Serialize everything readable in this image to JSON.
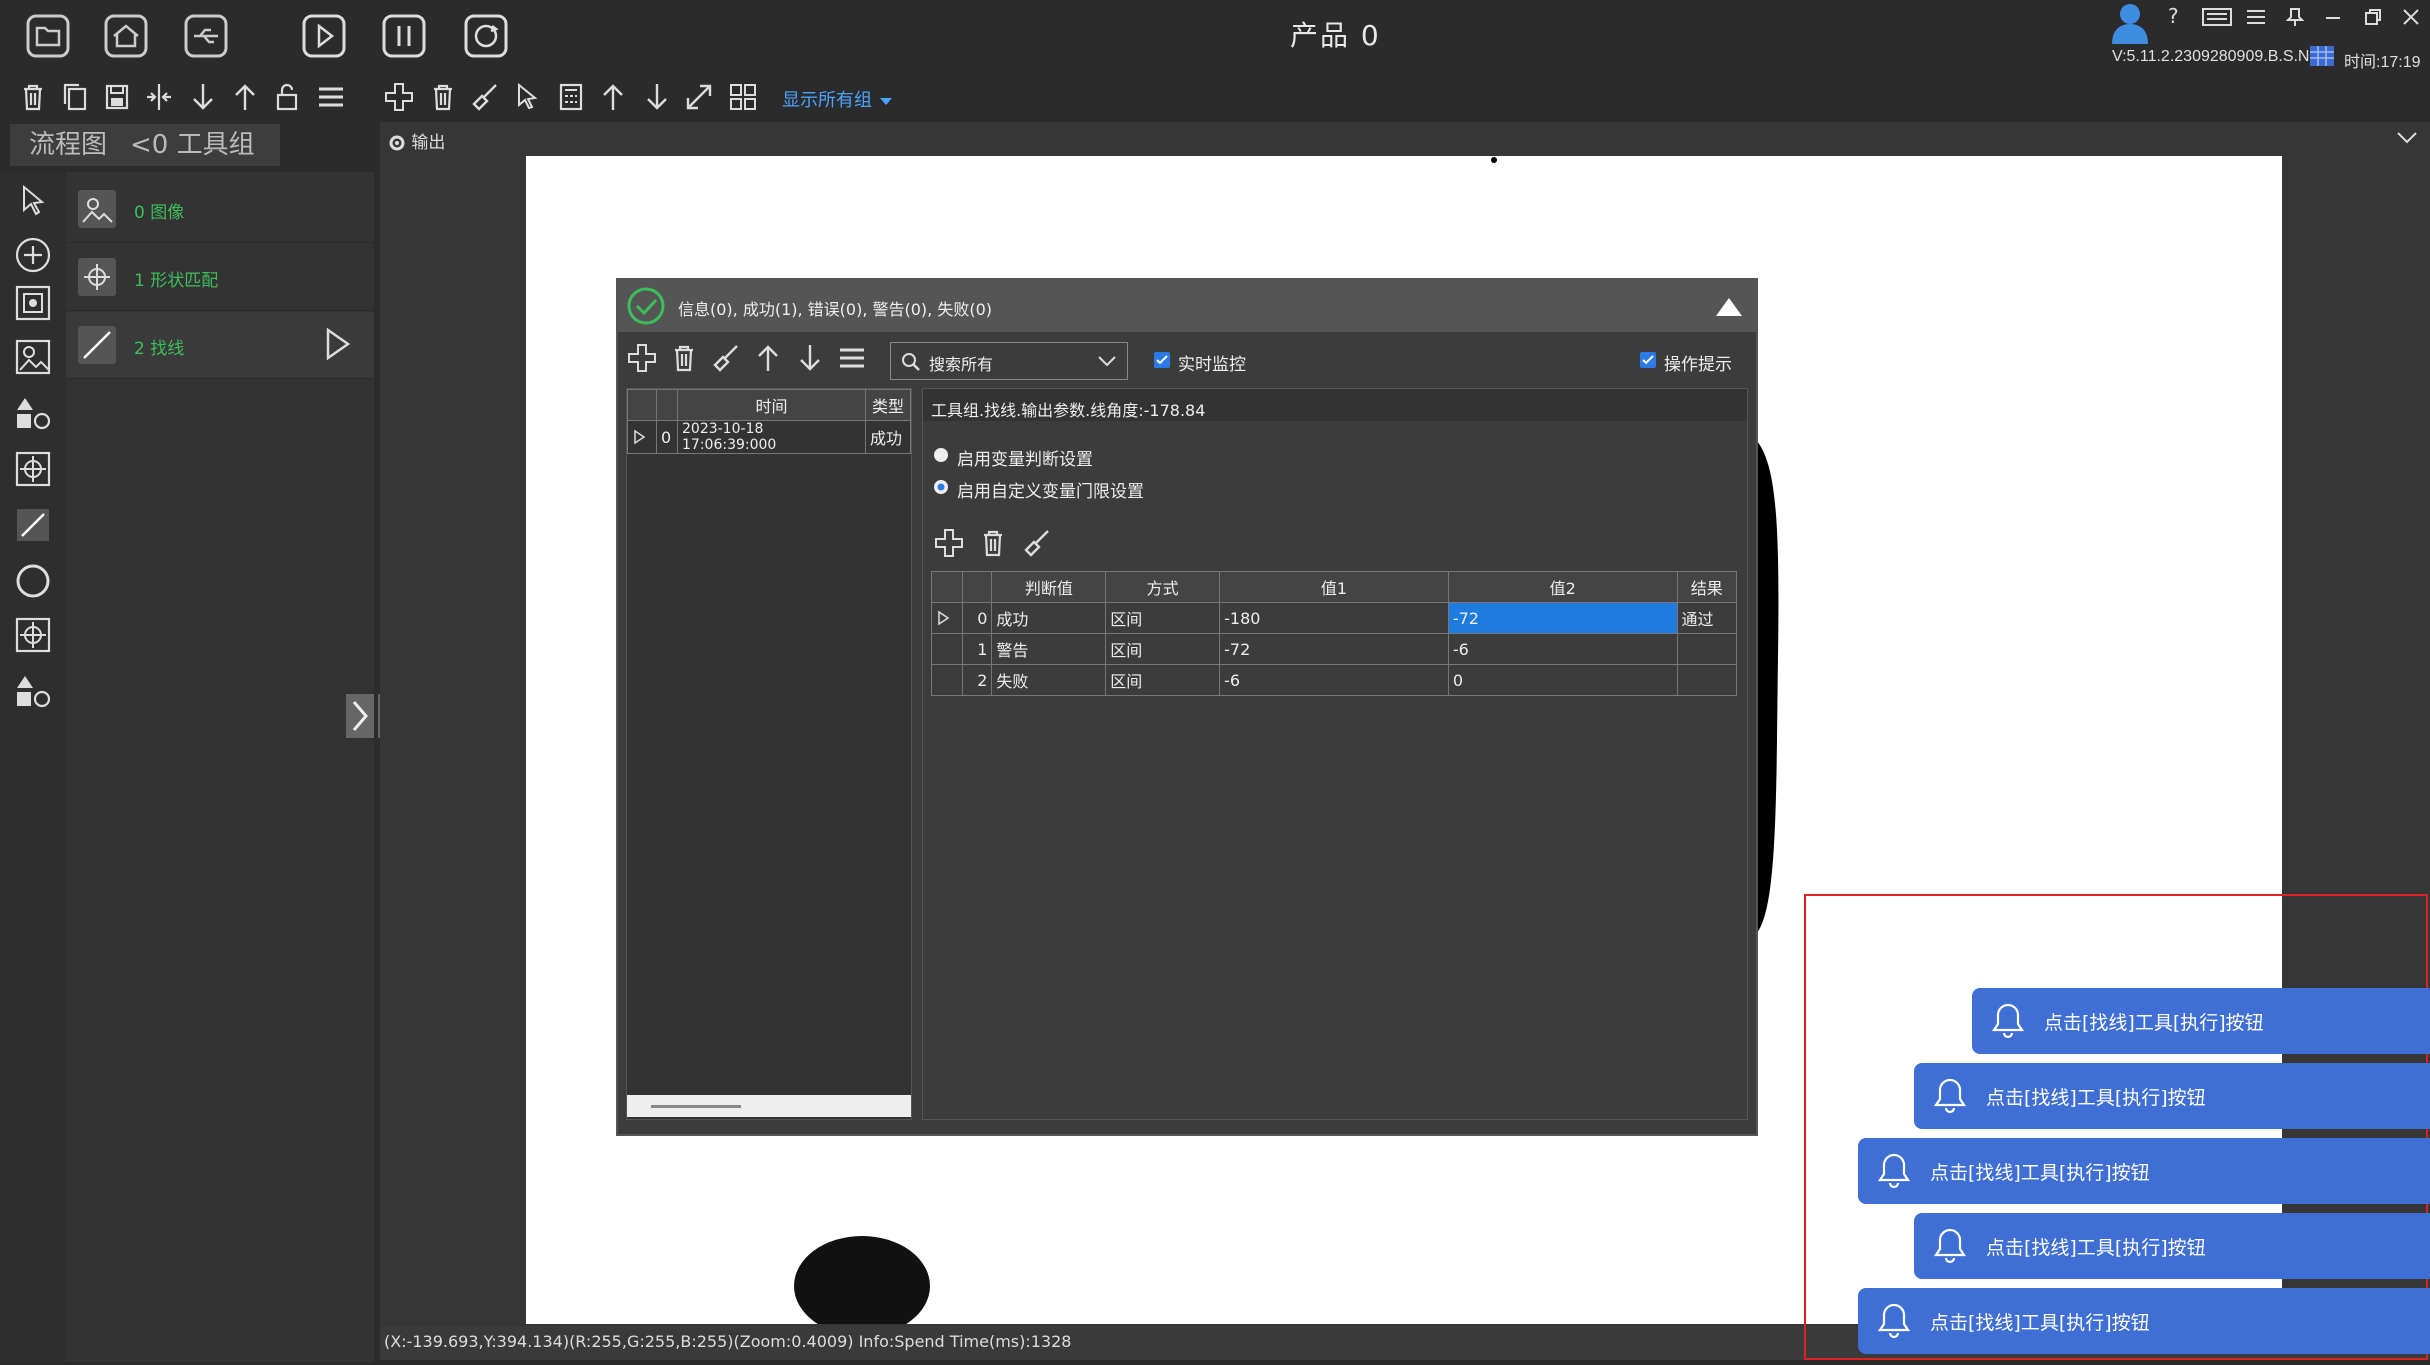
{
  "app": {
    "title": "产品 0",
    "version": "V:5.11.2.2309280909.B.S.N",
    "time": "时间:17:19"
  },
  "toolbar2": {
    "show_all_groups": "显示所有组"
  },
  "tabs": [
    {
      "label": "流程图"
    },
    {
      "label": "<0 工具组"
    }
  ],
  "nodes": [
    {
      "label": "0 图像"
    },
    {
      "label": "1 形状匹配"
    },
    {
      "label": "2 找线"
    }
  ],
  "output_header": "输出",
  "dialog": {
    "title": "信息(0), 成功(1), 错误(0), 警告(0), 失败(0)",
    "search_placeholder": "搜索所有",
    "realtime_monitor": "实时监控",
    "operation_hint": "操作提示",
    "log_table": {
      "headers": [
        "时间",
        "类型"
      ],
      "rows": [
        {
          "index": "0",
          "time": "2023-10-18 17:06:39:000",
          "type": "成功"
        }
      ]
    },
    "param_title": "工具组.找线.输出参数.线角度:-178.84",
    "radio_var_judge": "启用变量判断设置",
    "radio_custom_threshold": "启用自定义变量门限设置",
    "threshold_table": {
      "headers": [
        "判断值",
        "方式",
        "值1",
        "值2",
        "结果"
      ],
      "rows": [
        {
          "index": "0",
          "judge": "成功",
          "mode": "区间",
          "v1": "-180",
          "v2": "-72",
          "result": "通过"
        },
        {
          "index": "1",
          "judge": "警告",
          "mode": "区间",
          "v1": "-72",
          "v2": "-6",
          "result": ""
        },
        {
          "index": "2",
          "judge": "失败",
          "mode": "区间",
          "v1": "-6",
          "v2": "0",
          "result": ""
        }
      ]
    }
  },
  "status_bar": "(X:-139.693,Y:394.134)(R:255,G:255,B:255)(Zoom:0.4009)  Info:Spend Time(ms):1328",
  "notifications": [
    {
      "text": "点击[找线]工具[执行]按钮"
    },
    {
      "text": "点击[找线]工具[执行]按钮"
    },
    {
      "text": "点击[找线]工具[执行]按钮"
    },
    {
      "text": "点击[找线]工具[执行]按钮"
    },
    {
      "text": "点击[找线]工具[执行]按钮"
    }
  ],
  "colors": {
    "accent": "#2c7be5",
    "node_green": "#3cbf5a",
    "notify_blue": "#3f6fd4",
    "highlight": "#d22222"
  }
}
